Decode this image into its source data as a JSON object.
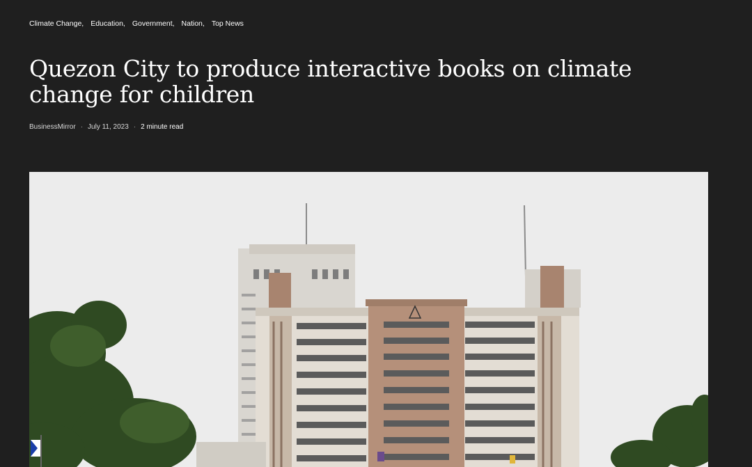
{
  "categories": [
    "Climate Change,",
    "Education,",
    "Government,",
    "Nation,",
    "Top News"
  ],
  "article": {
    "title": "Quezon City to produce interactive books on climate change for children",
    "author": "BusinessMirror",
    "date": "July 11, 2023",
    "read_time": "2 minute read"
  },
  "hero_image": {
    "description_icon": "city-hall-building-photo"
  },
  "colors": {
    "background": "#1f1f1f",
    "text": "#ffffff"
  }
}
